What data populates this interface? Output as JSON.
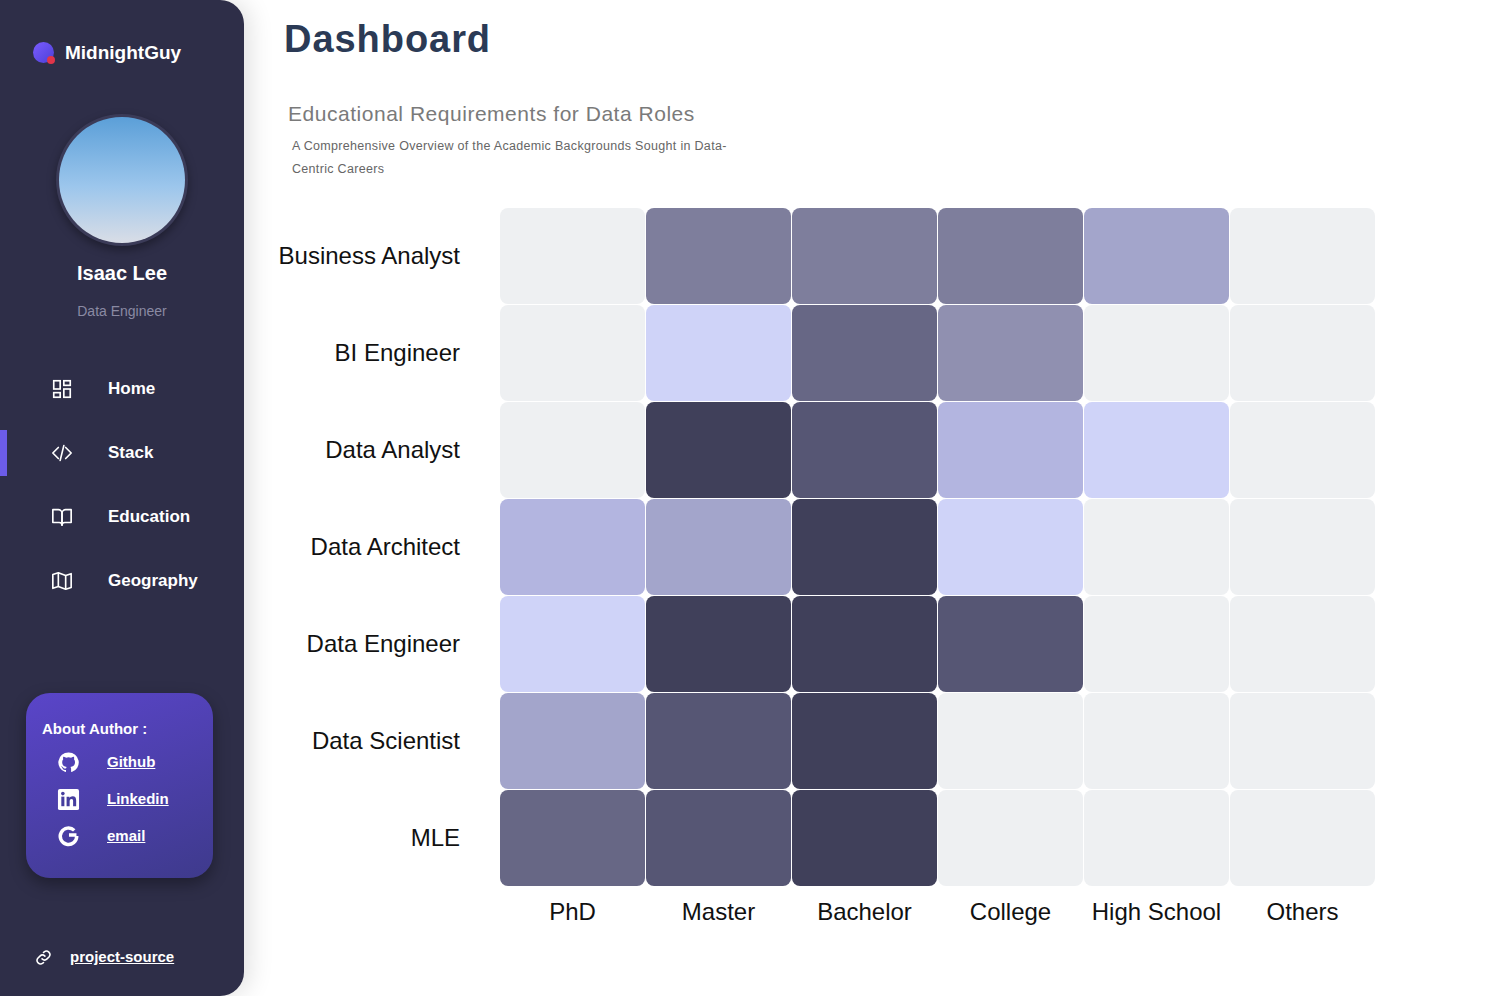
{
  "brand": {
    "name": "MidnightGuy"
  },
  "profile": {
    "name": "Isaac Lee",
    "role": "Data Engineer"
  },
  "sidebar": {
    "items": [
      {
        "label": "Home",
        "kind": "home",
        "selected": false
      },
      {
        "label": "Stack",
        "kind": "stack",
        "selected": true
      },
      {
        "label": "Education",
        "kind": "education",
        "selected": false
      },
      {
        "label": "Geography",
        "kind": "geography",
        "selected": false
      }
    ]
  },
  "about": {
    "title": "About Author :",
    "links": [
      {
        "label": "Github",
        "kind": "github"
      },
      {
        "label": "Linkedin",
        "kind": "linkedin"
      },
      {
        "label": "email",
        "kind": "email"
      }
    ]
  },
  "footer_link": {
    "label": "project-source"
  },
  "page": {
    "title": "Dashboard"
  },
  "chart": {
    "title": "Educational Requirements for Data Roles",
    "subtitle": "A Comprehensive Overview of the Academic Backgrounds Sought in Data-Centric Careers",
    "rows": [
      "Business Analyst",
      "BI Engineer",
      "Data Analyst",
      "Data Architect",
      "Data Engineer",
      "Data Scientist",
      "MLE"
    ],
    "columns": [
      "PhD",
      "Master",
      "Bachelor",
      "College",
      "High School",
      "Others"
    ],
    "values": [
      [
        0,
        5,
        5,
        5,
        3,
        0
      ],
      [
        0,
        1,
        6,
        4,
        0,
        0
      ],
      [
        0,
        8,
        7,
        2,
        1,
        0
      ],
      [
        2,
        3,
        8,
        1,
        0,
        0
      ],
      [
        1,
        8,
        8,
        7,
        0,
        0
      ],
      [
        3,
        7,
        8,
        0,
        0,
        0
      ],
      [
        6,
        7,
        8,
        0,
        0,
        0
      ]
    ]
  }
}
